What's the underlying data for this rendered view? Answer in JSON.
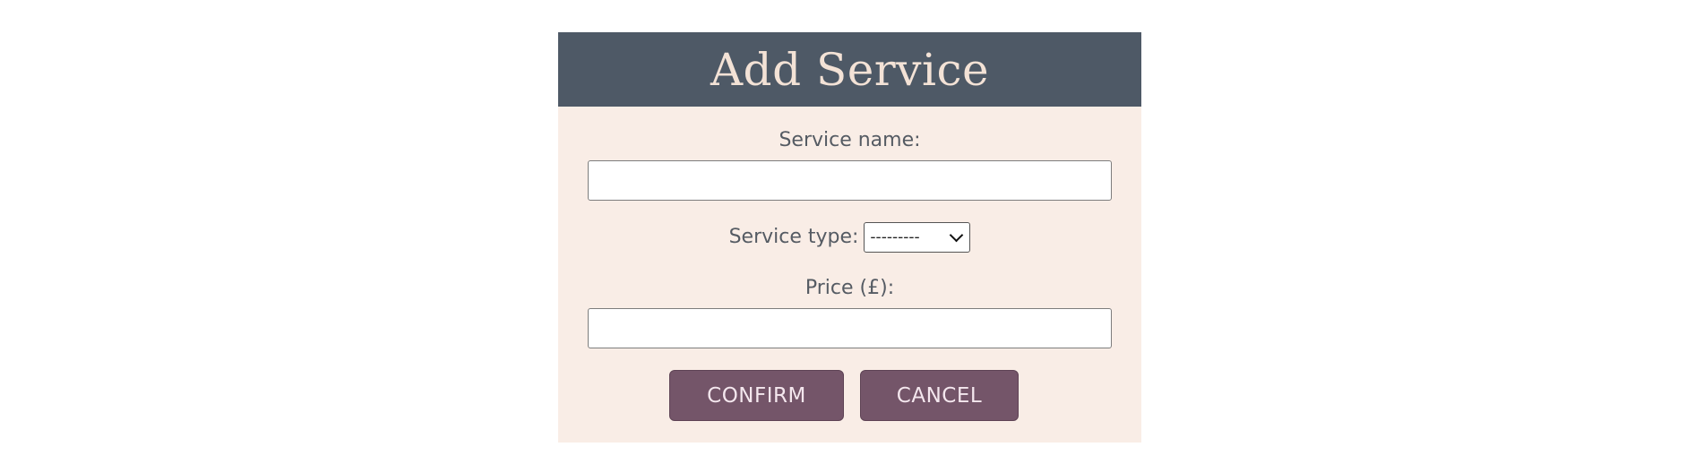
{
  "dialog": {
    "title": "Add Service",
    "service_name": {
      "label": "Service name:",
      "value": "",
      "placeholder": ""
    },
    "service_type": {
      "label": "Service type:",
      "selected": "---------"
    },
    "price": {
      "label": "Price (£):",
      "value": "",
      "placeholder": ""
    },
    "confirm_label": "CONFIRM",
    "cancel_label": "CANCEL"
  },
  "colors": {
    "header_bg": "#4e5966",
    "card_bg": "#f9ede6",
    "button_bg": "#745569",
    "title_text": "#f3e2d6",
    "label_text": "#555b63"
  }
}
